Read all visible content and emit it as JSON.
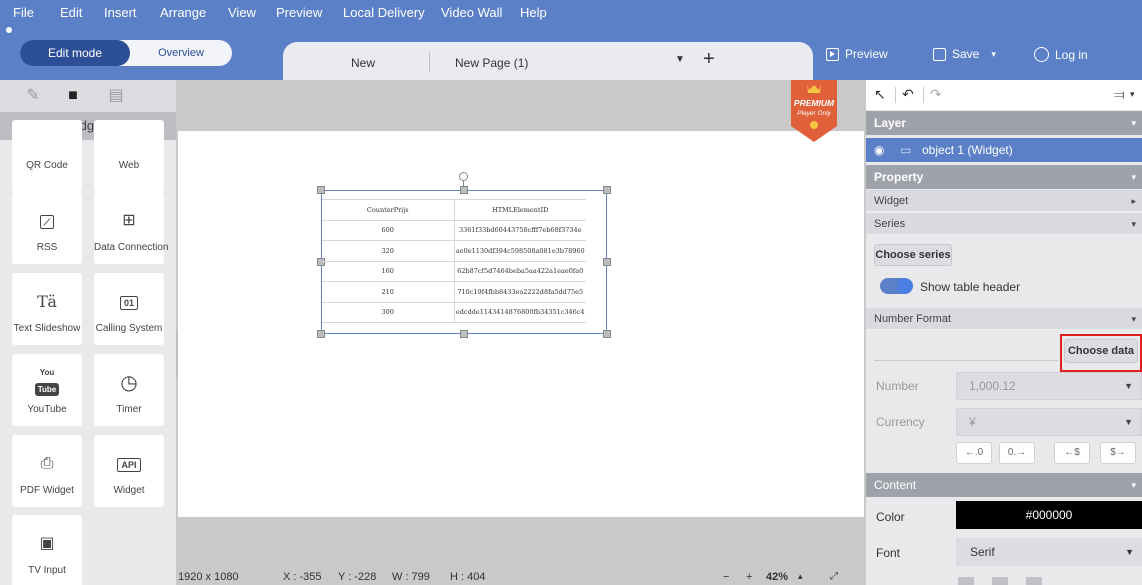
{
  "menu": [
    "File",
    "Edit",
    "Insert",
    "Arrange",
    "View",
    "Preview",
    "Local Delivery",
    "Video Wall",
    "Help"
  ],
  "mode": {
    "active": "Edit mode",
    "inactive": "Overview"
  },
  "tabs": {
    "first": "New",
    "second": "New Page (1)",
    "add": "+"
  },
  "top_actions": {
    "preview": "Preview",
    "save": "Save",
    "save_arrow": "▾",
    "login": "Log in"
  },
  "sidebar": {
    "header": "Widgets",
    "tiles": [
      {
        "label": "QR Code",
        "icon": "qr-code-icon"
      },
      {
        "label": "Web",
        "icon": "web-icon"
      },
      {
        "label": "RSS",
        "icon": "rss-icon"
      },
      {
        "label": "Data Connection",
        "icon": "data-connection-icon"
      },
      {
        "label": "Text Slideshow",
        "icon": "text-slideshow-icon",
        "glyph": "Tä"
      },
      {
        "label": "Calling System",
        "icon": "calling-system-icon",
        "glyph": "01"
      },
      {
        "label": "YouTube",
        "icon": "youtube-icon",
        "glyph_top": "You",
        "glyph_bottom": "Tube"
      },
      {
        "label": "Timer",
        "icon": "timer-icon"
      },
      {
        "label": "PDF Widget",
        "icon": "pdf-icon"
      },
      {
        "label": "Widget",
        "icon": "api-widget-icon",
        "glyph": "API"
      },
      {
        "label": "TV Input",
        "icon": "tv-input-icon"
      }
    ]
  },
  "canvas": {
    "premium": {
      "title": "PREMIUM",
      "subtitle": "Player Only"
    },
    "table": {
      "headers": [
        "CounterPrijs",
        "HTMLElementID"
      ],
      "rows": [
        [
          "600",
          "3361f33bd60443758cfff7eb68f3734e"
        ],
        [
          "320",
          "ae0e1130df394c598508a081e3b78960"
        ],
        [
          "160",
          "62b87cf5d7464beba5aa422a1eae0fa0"
        ],
        [
          "210",
          "710c19f4fbb8433ea2222d8fa5dd75e5"
        ],
        [
          "300",
          "edcdde1143414876800fb34351c346c4"
        ]
      ]
    }
  },
  "status": {
    "resolution": "1920 x 1080",
    "x": "X : -355",
    "y": "Y : -228",
    "w": "W : 799",
    "h": "H : 404",
    "zoom_out": "−",
    "zoom_in": "+",
    "zoom": "42%",
    "zoom_menu": "▴"
  },
  "panel": {
    "layer_title": "Layer",
    "layer_item": "object 1 (Widget)",
    "property_title": "Property",
    "widget_sub": "Widget",
    "series_sub": "Series",
    "choose_series": "Choose series",
    "show_table_header": "Show table header",
    "number_format_sub": "Number Format",
    "choose_data": "Choose data",
    "number_label": "Number",
    "number_value": "1,000.12",
    "currency_label": "Currency",
    "currency_value": "¥",
    "format_buttons": [
      "←.0",
      "0.→",
      "←$",
      "$→"
    ],
    "content_title": "Content",
    "color_label": "Color",
    "color_value": "#000000",
    "font_label": "Font",
    "font_value": "Serif"
  },
  "colors": {
    "accent": "#5b80c8",
    "accent_dark": "#2c4e96",
    "highlight": "#e02020",
    "premium": "#e0603a"
  }
}
